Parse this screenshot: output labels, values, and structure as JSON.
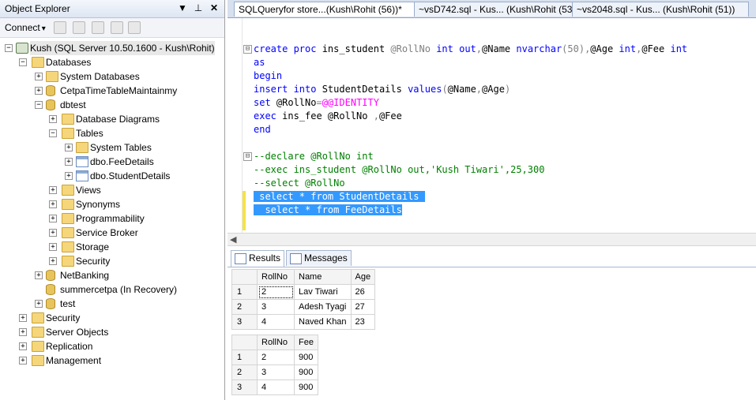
{
  "object_explorer": {
    "title": "Object Explorer",
    "pin_glyph": "⊥",
    "close_glyph": "✕",
    "dropdown_glyph": "▼",
    "toolbar": {
      "connect_label": "Connect",
      "connect_arrow": "▾"
    },
    "tree": [
      {
        "label": "Kush (SQL Server 10.50.1600 - Kush\\Rohit)",
        "icon": "server-icon",
        "expander": "⊟"
      },
      {
        "label": "Databases",
        "icon": "folder-icon",
        "expander": "⊟"
      },
      {
        "label": "System Databases",
        "icon": "folder-icon",
        "expander": "⊞"
      },
      {
        "label": "CetpaTimeTableMaintainmy",
        "icon": "database-icon",
        "expander": "⊞"
      },
      {
        "label": "dbtest",
        "icon": "database-icon",
        "expander": "⊟"
      },
      {
        "label": "Database Diagrams",
        "icon": "folder-icon",
        "expander": "⊞"
      },
      {
        "label": "Tables",
        "icon": "folder-icon",
        "expander": "⊟"
      },
      {
        "label": "System Tables",
        "icon": "folder-icon",
        "expander": "⊞"
      },
      {
        "label": "dbo.FeeDetails",
        "icon": "table-icon",
        "expander": "⊞"
      },
      {
        "label": "dbo.StudentDetails",
        "icon": "table-icon",
        "expander": "⊞"
      },
      {
        "label": "Views",
        "icon": "folder-icon",
        "expander": "⊞"
      },
      {
        "label": "Synonyms",
        "icon": "folder-icon",
        "expander": "⊞"
      },
      {
        "label": "Programmability",
        "icon": "folder-icon",
        "expander": "⊞"
      },
      {
        "label": "Service Broker",
        "icon": "folder-icon",
        "expander": "⊞"
      },
      {
        "label": "Storage",
        "icon": "folder-icon",
        "expander": "⊞"
      },
      {
        "label": "Security",
        "icon": "folder-icon",
        "expander": "⊞"
      },
      {
        "label": "NetBanking",
        "icon": "database-icon",
        "expander": "⊞"
      },
      {
        "label": "summercetpa (In Recovery)",
        "icon": "database-icon",
        "expander": ""
      },
      {
        "label": "test",
        "icon": "database-icon",
        "expander": "⊞"
      },
      {
        "label": "Security",
        "icon": "folder-icon",
        "expander": "⊞"
      },
      {
        "label": "Server Objects",
        "icon": "folder-icon",
        "expander": "⊞"
      },
      {
        "label": "Replication",
        "icon": "folder-icon",
        "expander": "⊞"
      },
      {
        "label": "Management",
        "icon": "folder-icon",
        "expander": "⊞"
      }
    ]
  },
  "document_tabs": [
    {
      "label": "SQLQueryfor store...(Kush\\Rohit (56))*",
      "close": "✕",
      "active": true
    },
    {
      "label": "~vsD742.sql - Kus... (Kush\\Rohit (53))",
      "active": false
    },
    {
      "label": "~vs2048.sql - Kus... (Kush\\Rohit (51))",
      "active": false
    }
  ],
  "editor": {
    "fold_collapse": "⊟",
    "lines": [
      {
        "parts": [
          [
            "kw",
            "create proc "
          ],
          [
            "",
            "ins_student "
          ],
          [
            "gr",
            "@RollNo "
          ],
          [
            "kw",
            "int out"
          ],
          [
            "gr",
            ","
          ],
          [
            "",
            "@Name "
          ],
          [
            "kw",
            "nvarchar"
          ],
          [
            "gr",
            "(50),"
          ],
          [
            "",
            "@Age "
          ],
          [
            "kw",
            "int"
          ],
          [
            "gr",
            ","
          ],
          [
            "",
            "@Fee "
          ],
          [
            "kw",
            "int"
          ]
        ]
      },
      {
        "parts": [
          [
            "kw",
            "as"
          ]
        ]
      },
      {
        "parts": [
          [
            "kw",
            "begin"
          ]
        ]
      },
      {
        "parts": [
          [
            "kw",
            "insert into "
          ],
          [
            "",
            "StudentDetails "
          ],
          [
            "kw",
            "values"
          ],
          [
            "gr",
            "("
          ],
          [
            "",
            "@Name"
          ],
          [
            "gr",
            ","
          ],
          [
            "",
            "@Age"
          ],
          [
            "gr",
            ")"
          ]
        ]
      },
      {
        "parts": [
          [
            "kw",
            "set "
          ],
          [
            "",
            "@RollNo"
          ],
          [
            "gr",
            "="
          ],
          [
            "fn",
            "@@IDENTITY"
          ]
        ]
      },
      {
        "parts": [
          [
            "kw",
            "exec "
          ],
          [
            "",
            "ins_fee @RollNo "
          ],
          [
            "gr",
            ","
          ],
          [
            "",
            "@Fee"
          ]
        ]
      },
      {
        "parts": [
          [
            "kw",
            "end"
          ]
        ]
      },
      {
        "parts": []
      },
      {
        "parts": [
          [
            "cm",
            "--declare @RollNo int"
          ]
        ]
      },
      {
        "parts": [
          [
            "cm",
            "--exec ins_student @RollNo out,'Kush Tiwari',25,300"
          ]
        ]
      },
      {
        "parts": [
          [
            "cm",
            "--select @RollNo"
          ]
        ]
      },
      {
        "parts": [
          [
            "sel",
            " select * from StudentDetails "
          ]
        ]
      },
      {
        "parts": [
          [
            "sel",
            "  select * from FeeDetails"
          ]
        ]
      }
    ]
  },
  "results_tabs": [
    {
      "label": "Results",
      "active": true
    },
    {
      "label": "Messages",
      "active": false
    }
  ],
  "grids": [
    {
      "columns": [
        "RollNo",
        "Name",
        "Age"
      ],
      "rows": [
        {
          "n": "1",
          "cells": [
            "2",
            "Lav Tiwari",
            "26"
          ]
        },
        {
          "n": "2",
          "cells": [
            "3",
            "Adesh Tyagi",
            "27"
          ]
        },
        {
          "n": "3",
          "cells": [
            "4",
            "Naved Khan",
            "23"
          ]
        }
      ]
    },
    {
      "columns": [
        "RollNo",
        "Fee"
      ],
      "rows": [
        {
          "n": "1",
          "cells": [
            "2",
            "900"
          ]
        },
        {
          "n": "2",
          "cells": [
            "3",
            "900"
          ]
        },
        {
          "n": "3",
          "cells": [
            "4",
            "900"
          ]
        }
      ]
    }
  ]
}
